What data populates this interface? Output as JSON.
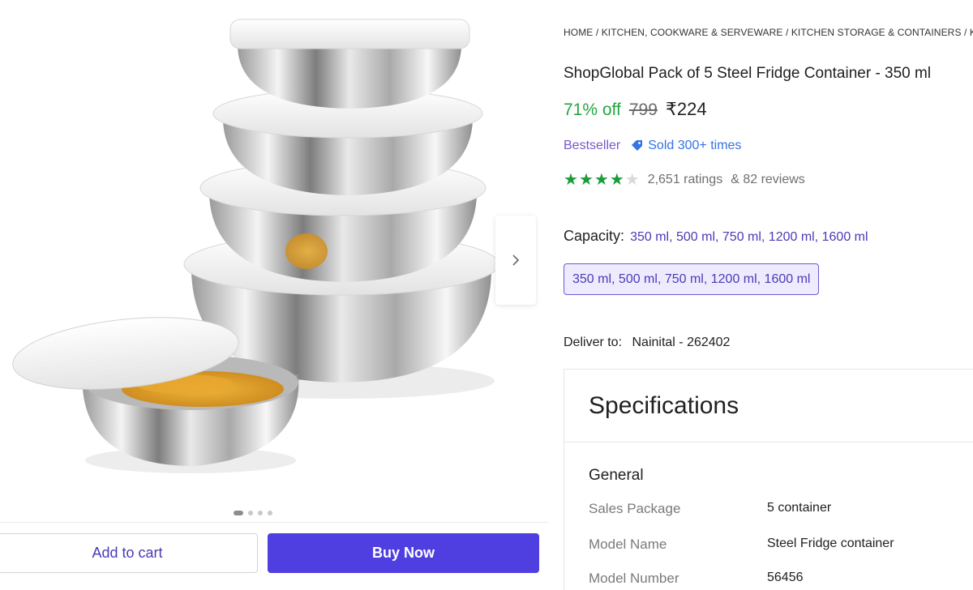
{
  "breadcrumb": "HOME / KITCHEN, COOKWARE & SERVEWARE / KITCHEN STORAGE & CONTAINERS / K",
  "product": {
    "title": "ShopGlobal Pack of 5 Steel Fridge Container  - 350 ml",
    "discount": "71% off",
    "mrp": "799",
    "price": "₹224",
    "bestseller": "Bestseller",
    "sold": "Sold 300+ times",
    "rating_value": 4,
    "ratings": "2,651 ratings",
    "reviews": "& 82 reviews"
  },
  "capacity": {
    "label": "Capacity:",
    "value": "350 ml, 500 ml, 750 ml, 1200 ml, 1600 ml",
    "selected_option": "350 ml, 500 ml, 750 ml, 1200 ml, 1600 ml"
  },
  "delivery": {
    "label": "Deliver to:",
    "location": "Nainital - 262402"
  },
  "gallery": {
    "image_count": 4,
    "active_index": 0
  },
  "actions": {
    "add_to_cart": "Add to cart",
    "buy_now": "Buy Now"
  },
  "specifications": {
    "heading": "Specifications",
    "section": "General",
    "rows": [
      {
        "key": "Sales Package",
        "value": "5 container"
      },
      {
        "key": "Model Name",
        "value": "Steel Fridge container"
      },
      {
        "key": "Model Number",
        "value": "56456"
      }
    ]
  },
  "colors": {
    "accent": "#4f3fe0",
    "discount_green": "#26a541",
    "star_green": "#1b9c3a",
    "sold_blue": "#3573e6"
  },
  "icons": [
    "chevron-right-icon",
    "star-icon",
    "tag-icon"
  ]
}
